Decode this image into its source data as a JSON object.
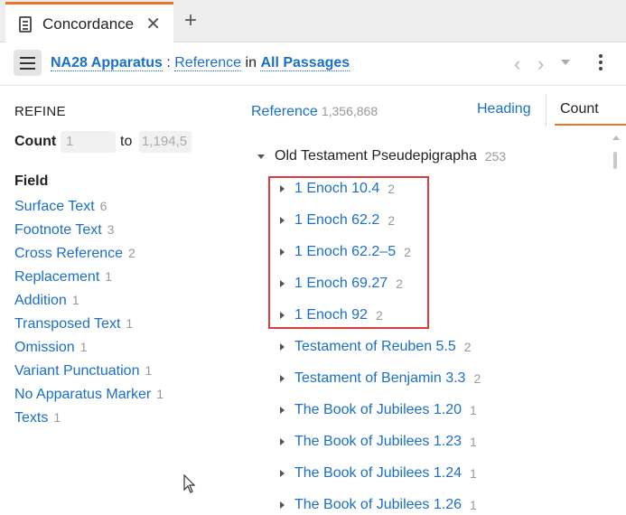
{
  "tab": {
    "title": "Concordance",
    "close_glyph": "✕",
    "add_glyph": "+"
  },
  "header": {
    "resource": "NA28 Apparatus",
    "separator": ":",
    "field": "Reference",
    "in_word": "in",
    "scope": "All Passages"
  },
  "refine": {
    "title": "REFINE",
    "count_label": "Count",
    "count_min": "1",
    "count_to": "to",
    "count_max": "1,194,5"
  },
  "field_section": {
    "title": "Field",
    "items": [
      {
        "label": "Surface Text",
        "count": "6"
      },
      {
        "label": "Footnote Text",
        "count": "3"
      },
      {
        "label": "Cross Reference",
        "count": "2"
      },
      {
        "label": "Replacement",
        "count": "1"
      },
      {
        "label": "Addition",
        "count": "1"
      },
      {
        "label": "Transposed Text",
        "count": "1"
      },
      {
        "label": "Omission",
        "count": "1"
      },
      {
        "label": "Variant Punctuation",
        "count": "1"
      },
      {
        "label": "No Apparatus Marker",
        "count": "1"
      },
      {
        "label": "Texts",
        "count": "1"
      }
    ]
  },
  "results": {
    "column_label": "Reference",
    "column_count": "1,356,868",
    "sort_heading": "Heading",
    "sort_count": "Count",
    "group": {
      "label": "Old Testament Pseudepigrapha",
      "count": "253"
    },
    "items": [
      {
        "label": "1 Enoch 10.4",
        "count": "2"
      },
      {
        "label": "1 Enoch 62.2",
        "count": "2"
      },
      {
        "label": "1 Enoch 62.2–5",
        "count": "2"
      },
      {
        "label": "1 Enoch 69.27",
        "count": "2"
      },
      {
        "label": "1 Enoch 92",
        "count": "2"
      },
      {
        "label": "Testament of Reuben 5.5",
        "count": "2"
      },
      {
        "label": "Testament of Benjamin 3.3",
        "count": "2"
      },
      {
        "label": "The Book of Jubilees 1.20",
        "count": "1"
      },
      {
        "label": "The Book of Jubilees 1.23",
        "count": "1"
      },
      {
        "label": "The Book of Jubilees 1.24",
        "count": "1"
      },
      {
        "label": "The Book of Jubilees 1.26",
        "count": "1"
      }
    ]
  },
  "colors": {
    "accent": "#e8772b",
    "link": "#1a6fc9",
    "highlight_box": "#e0393e"
  },
  "icons": {
    "tab": "concordance-icon",
    "menu": "hamburger-icon",
    "back": "chevron-left-icon",
    "forward": "chevron-right-icon",
    "history": "dropdown-caret-icon",
    "more": "kebab-icon"
  }
}
